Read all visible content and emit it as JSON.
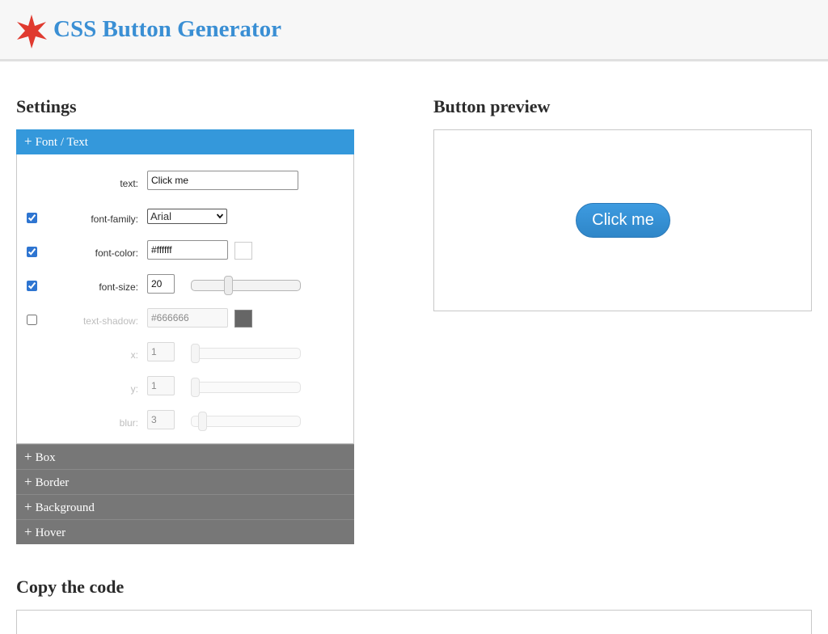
{
  "header": {
    "title": "CSS Button Generator",
    "logo_icon": "red-star-icon",
    "logo_color": "#e03a2f",
    "title_color": "#3a8fd4"
  },
  "settings": {
    "title": "Settings",
    "sections": [
      {
        "label": "Font / Text",
        "expanded": true
      },
      {
        "label": "Box",
        "expanded": false
      },
      {
        "label": "Border",
        "expanded": false
      },
      {
        "label": "Background",
        "expanded": false
      },
      {
        "label": "Hover",
        "expanded": false
      }
    ],
    "font": {
      "text": {
        "label": "text:",
        "value": "Click me"
      },
      "font_family": {
        "label": "font-family:",
        "value": "Arial",
        "checked": true
      },
      "font_color": {
        "label": "font-color:",
        "value": "#ffffff",
        "checked": true,
        "swatch": "#ffffff"
      },
      "font_size": {
        "label": "font-size:",
        "value": "20",
        "checked": true,
        "slider_fraction": 0.33
      },
      "text_shadow": {
        "label": "text-shadow:",
        "value": "#666666",
        "checked": false,
        "swatch": "#666666"
      },
      "x": {
        "label": "x:",
        "value": "1",
        "slider_fraction": 0.0
      },
      "y": {
        "label": "y:",
        "value": "1",
        "slider_fraction": 0.0
      },
      "blur": {
        "label": "blur:",
        "value": "3",
        "slider_fraction": 0.07
      }
    }
  },
  "preview": {
    "title": "Button preview",
    "button_label": "Click me",
    "accent": "#3498db"
  },
  "code": {
    "title": "Copy the code"
  }
}
